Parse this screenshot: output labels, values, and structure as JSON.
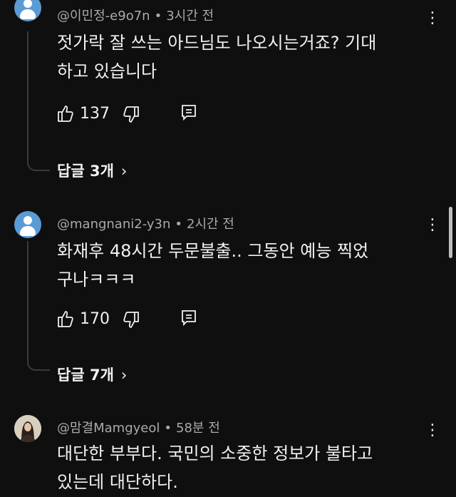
{
  "comments": [
    {
      "author": "@이민정-e9o7n",
      "time": "3시간 전",
      "text_lines": [
        "젓가락 잘 쓰는 아드님도 나오시는거죠? 기대",
        "하고 있습니다"
      ],
      "likes": "137",
      "replies_label": "답글 3개",
      "avatar": "default-avatar-icon"
    },
    {
      "author": "@mangnani2-y3n",
      "time": "2시간 전",
      "text_lines": [
        "화재후 48시간 두문불출.. 그동안 예능 찍었",
        "구나ㅋㅋㅋ"
      ],
      "likes": "170",
      "replies_label": "답글 7개",
      "avatar": "default-avatar-icon"
    },
    {
      "author": "@맘결Mamgyeol",
      "time": "58분 전",
      "text_lines": [
        "대단한  부부다. 국민의 소중한 정보가 불타고",
        "있는데  대단하다."
      ],
      "avatar": "photo-avatar"
    }
  ],
  "ui": {
    "separator": "•",
    "reply_chevron": "›",
    "kebab": "⋮"
  },
  "colors": {
    "background": "#0f0f0f",
    "primary_text": "#f1f1f1",
    "secondary_text": "#aaaaaa",
    "avatar_blue": "#5b9bd5"
  }
}
